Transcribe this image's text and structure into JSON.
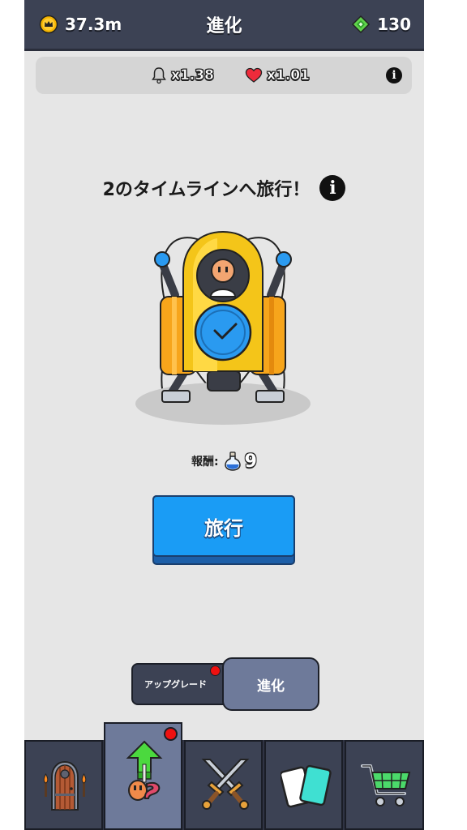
{
  "header": {
    "gold": "37.3m",
    "title": "進化",
    "gems": "130"
  },
  "multipliers": {
    "bell": "x1.38",
    "heart": "x1.01"
  },
  "main": {
    "heading": "2のタイムラインへ旅行！",
    "reward_label": "報酬:",
    "reward_value": "9",
    "travel_button": "旅行"
  },
  "toggle": {
    "upgrade": "アップグレード",
    "evolve": "進化"
  },
  "icons": {
    "gold": "crown-coin-icon",
    "gems": "green-gem-icon",
    "bell": "bell-icon",
    "heart": "heart-icon",
    "info": "info-icon",
    "reward": "blue-potion-icon",
    "tabs": [
      "door-icon",
      "evolve-arrow-icon",
      "crossed-swords-icon",
      "cards-icon",
      "shopping-cart-icon"
    ]
  },
  "colors": {
    "topbar": "#3c4254",
    "background": "#e6e6e6",
    "travel_button": "#1a9cf5",
    "active_tab": "#6e7a9a",
    "notification": "#ee1111"
  }
}
